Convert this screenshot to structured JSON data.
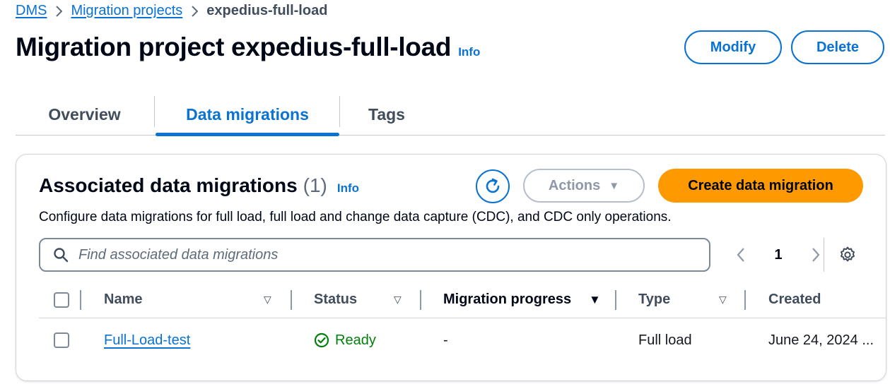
{
  "breadcrumb": {
    "items": [
      "DMS",
      "Migration projects"
    ],
    "current": "expedius-full-load"
  },
  "header": {
    "title": "Migration project expedius-full-load",
    "info": "Info",
    "modify_label": "Modify",
    "delete_label": "Delete"
  },
  "tabs": [
    "Overview",
    "Data migrations",
    "Tags"
  ],
  "active_tab": "Data migrations",
  "container": {
    "title": "Associated data migrations",
    "count": "(1)",
    "info": "Info",
    "actions_label": "Actions",
    "create_label": "Create data migration",
    "description": "Configure data migrations for full load, full load and change data capture (CDC), and CDC only operations.",
    "search_placeholder": "Find associated data migrations",
    "page": "1"
  },
  "table": {
    "columns": [
      "Name",
      "Status",
      "Migration progress",
      "Type",
      "Created"
    ],
    "rows": [
      {
        "name": "Full-Load-test",
        "status": "Ready",
        "progress": "-",
        "type": "Full load",
        "created": "June 24, 2024 ..."
      }
    ]
  },
  "colors": {
    "link": "#0972d3",
    "primary_button": "#ff9900",
    "success": "#037f0c"
  },
  "icons": [
    "chevron-right-icon",
    "refresh-icon",
    "caret-down-icon",
    "search-icon",
    "chevron-left-icon",
    "settings-gear-icon",
    "sort-icon",
    "status-check-icon"
  ]
}
